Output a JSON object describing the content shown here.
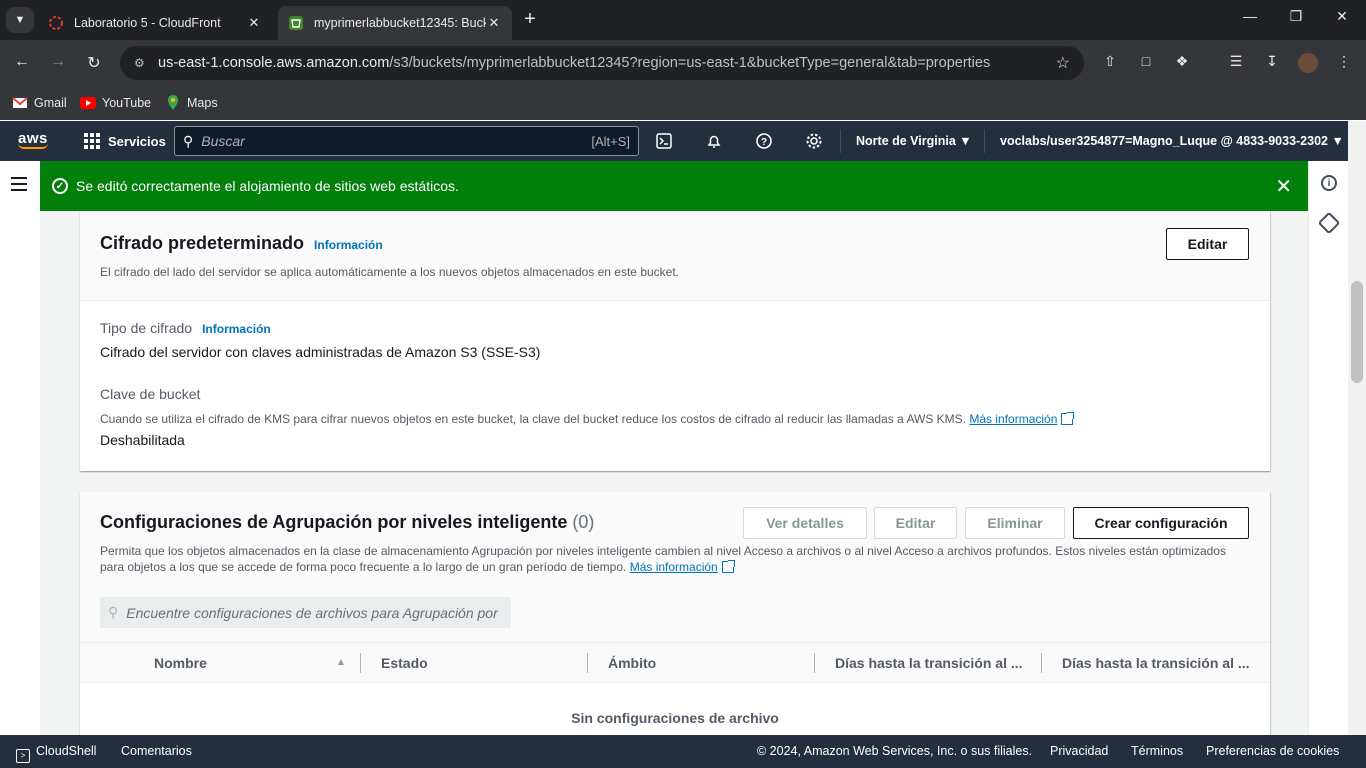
{
  "browser": {
    "tabs": [
      {
        "title": "Laboratorio 5 - CloudFront",
        "icon": "aws-academy-icon"
      },
      {
        "title": "myprimerlabbucket12345: Buck",
        "icon": "s3-bucket-icon"
      }
    ],
    "url_host": "us-east-1.console.aws.amazon.com",
    "url_path": "/s3/buckets/myprimerlabbucket12345?region=us-east-1&bucketType=general&tab=properties",
    "bookmarks": [
      {
        "label": "Gmail",
        "icon": "gmail-icon"
      },
      {
        "label": "YouTube",
        "icon": "youtube-icon"
      },
      {
        "label": "Maps",
        "icon": "maps-icon"
      }
    ]
  },
  "aws": {
    "logo": "aws",
    "services_label": "Servicios",
    "search_placeholder": "Buscar",
    "search_shortcut": "[Alt+S]",
    "region": "Norte de Virginia",
    "account": "voclabs/user3254877=Magno_Luque @ 4833-9033-2302"
  },
  "flash": {
    "message": "Se editó correctamente el alojamiento de sitios web estáticos.",
    "color": "#037f0c"
  },
  "encryption": {
    "title": "Cifrado predeterminado",
    "info": "Información",
    "description": "El cifrado del lado del servidor se aplica automáticamente a los nuevos objetos almacenados en este bucket.",
    "edit_label": "Editar",
    "type_label": "Tipo de cifrado",
    "type_info": "Información",
    "type_value": "Cifrado del servidor con claves administradas de Amazon S3 (SSE-S3)",
    "bucket_key_label": "Clave de bucket",
    "bucket_key_desc": "Cuando se utiliza el cifrado de KMS para cifrar nuevos objetos en este bucket, la clave del bucket reduce los costos de cifrado al reducir las llamadas a AWS KMS.",
    "more_info": "Más información",
    "bucket_key_value": "Deshabilitada"
  },
  "tiering": {
    "title": "Configuraciones de Agrupación por niveles inteligente",
    "count": "(0)",
    "buttons": {
      "details": "Ver detalles",
      "edit": "Editar",
      "delete": "Eliminar",
      "create": "Crear configuración"
    },
    "description_line1": "Permita que los objetos almacenados en la clase de almacenamiento Agrupación por niveles inteligente cambien al nivel Acceso a archivos o al nivel Acceso a archivos profundos. Estos niveles están optimizados",
    "description_line2": "para objetos a los que se accede de forma poco frecuente a lo largo de un gran período de tiempo.",
    "more_info": "Más información",
    "filter_placeholder": "Encuentre configuraciones de archivos para Agrupación por",
    "columns": [
      "Nombre",
      "Estado",
      "Ámbito",
      "Días hasta la transición al ...",
      "Días hasta la transición al ..."
    ],
    "empty": "Sin configuraciones de archivo"
  },
  "footer": {
    "cloudshell": "CloudShell",
    "feedback": "Comentarios",
    "copyright": "© 2024, Amazon Web Services, Inc. o sus filiales.",
    "privacy": "Privacidad",
    "terms": "Términos",
    "cookies": "Preferencias de cookies"
  }
}
